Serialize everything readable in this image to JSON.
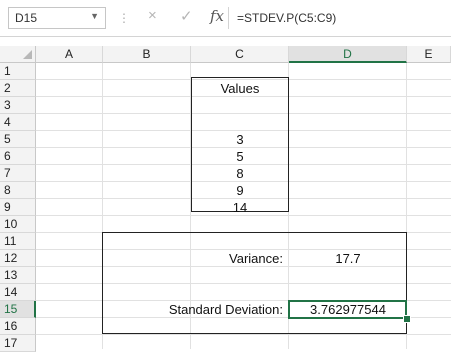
{
  "formula_bar": {
    "name_box": "D15",
    "cancel_icon": "×",
    "enter_icon": "✓",
    "fx_label": "fx",
    "formula": "=STDEV.P(C5:C9)"
  },
  "columns": [
    "A",
    "B",
    "C",
    "D",
    "E"
  ],
  "rows": [
    "1",
    "2",
    "3",
    "4",
    "5",
    "6",
    "7",
    "8",
    "9",
    "10",
    "11",
    "12",
    "13",
    "14",
    "15",
    "16",
    "17"
  ],
  "cells": {
    "c2": "Values",
    "c5": "3",
    "c6": "5",
    "c7": "8",
    "c8": "9",
    "c9": "14",
    "c12": "Variance:",
    "d12": "17.7",
    "c15": "Standard Deviation:",
    "d15": "3.762977544"
  },
  "colors": {
    "accent": "#217346"
  }
}
